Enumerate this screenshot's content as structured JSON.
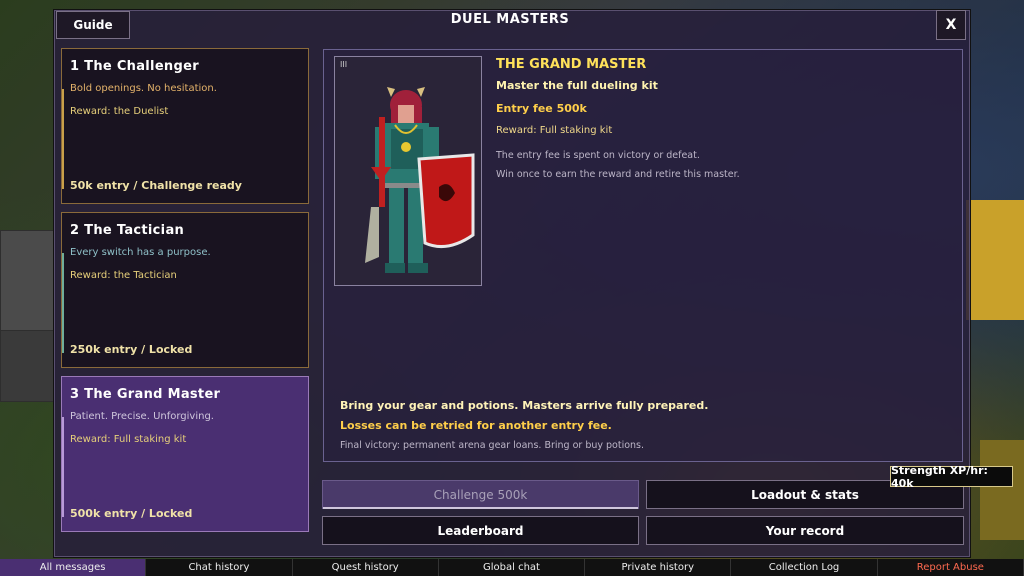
{
  "header": {
    "title": "DUEL MASTERS",
    "guide_label": "Guide",
    "close_label": "X"
  },
  "masters": [
    {
      "title": "1  The Challenger",
      "motto": "Bold openings. No hesitation.",
      "reward": "Reward: the Duelist",
      "status": "50k entry  /  Challenge ready",
      "accent": "#c9a04a",
      "motto_color": "#e3b26a"
    },
    {
      "title": "2  The Tactician",
      "motto": "Every switch has a purpose.",
      "reward": "Reward: the Tactician",
      "status": "250k entry  /  Locked",
      "accent": "#6fae9a",
      "motto_color": "#8fc0c8"
    },
    {
      "title": "3  The Grand Master",
      "motto": "Patient. Precise. Unforgiving.",
      "reward": "Reward: Full staking kit",
      "status": "500k entry  /  Locked",
      "accent": "#9a7ab8",
      "motto_color": "#cfc6dc"
    }
  ],
  "detail": {
    "portrait_tag": "III",
    "name": "THE GRAND MASTER",
    "subtitle": "Master the full dueling kit",
    "fee": "Entry fee 500k",
    "reward": "Reward: Full staking kit",
    "note1": "The entry fee is spent on victory or defeat.",
    "note2": "Win once to earn the reward and retire this master.",
    "bottom1": "Bring your gear and potions. Masters arrive fully prepared.",
    "bottom2": "Losses can be retried for another entry fee.",
    "bottom3": "Final victory: permanent arena gear loans. Bring or buy potions."
  },
  "actions": {
    "challenge": "Challenge 500k",
    "loadout": "Loadout & stats",
    "leaderboard": "Leaderboard",
    "record": "Your record"
  },
  "tooltip": "Strength XP/hr: 40k",
  "chat_tabs": [
    "All messages",
    "Chat history",
    "Quest history",
    "Global chat",
    "Private history",
    "Collection Log",
    "Report Abuse"
  ]
}
